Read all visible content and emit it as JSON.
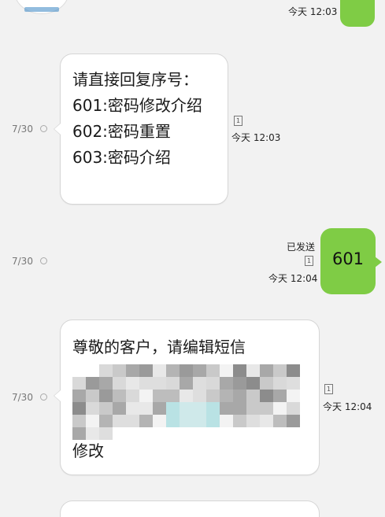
{
  "top": {
    "time": "今天 12:03"
  },
  "messages": [
    {
      "id": "m1",
      "direction": "incoming",
      "date": "7/30",
      "lines": [
        "请直接回复序号：",
        "601:密码修改介绍",
        "602:密码重置",
        "603:密码介绍"
      ],
      "sim_slot": "1",
      "time": "今天 12:03"
    },
    {
      "id": "m2",
      "direction": "outgoing",
      "date": "7/30",
      "text": "601",
      "status": "已发送",
      "sim_slot": "1",
      "time": "今天 12:04"
    },
    {
      "id": "m3",
      "direction": "incoming",
      "date": "7/30",
      "lines": [
        "尊敬的客户，请编辑短信"
      ],
      "last_visible": "修改",
      "obscured": true,
      "sim_slot": "1",
      "time": "今天 12:04"
    }
  ],
  "colors": {
    "outgoing_bubble": "#7fcc45",
    "background": "#f2f2f2",
    "incoming_bubble": "#ffffff"
  }
}
